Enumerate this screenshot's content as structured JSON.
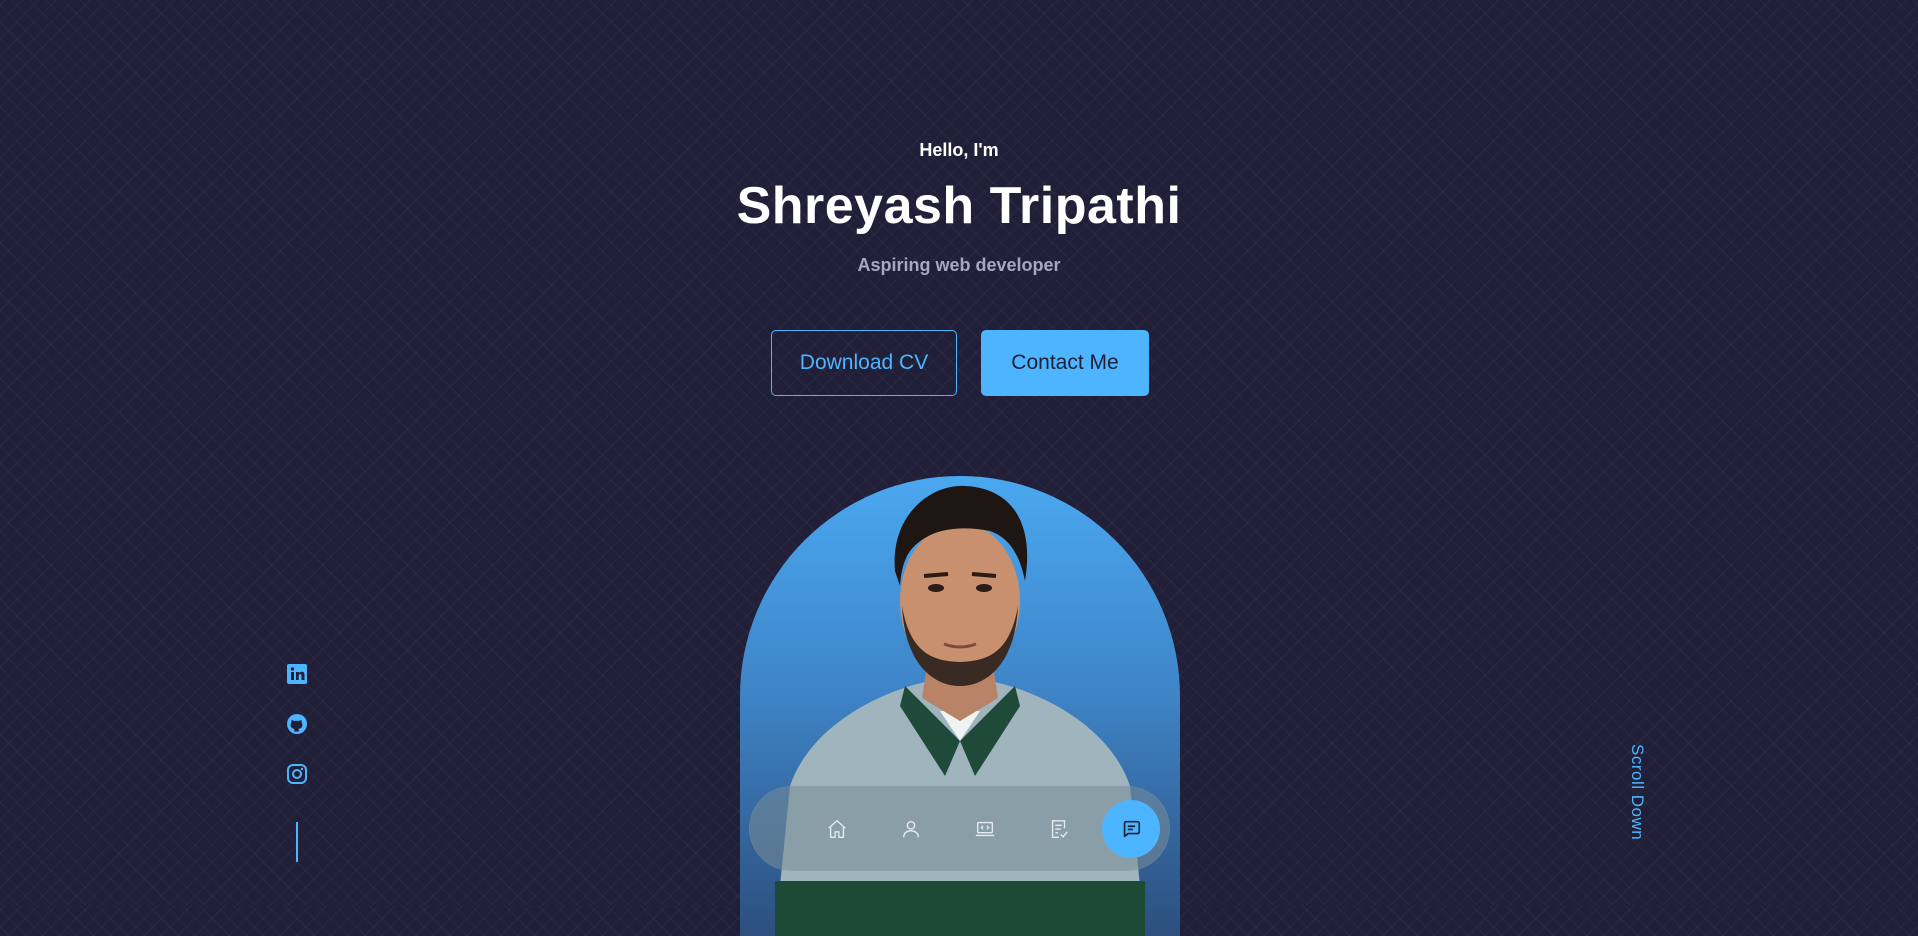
{
  "hero": {
    "greeting": "Hello, I'm",
    "name": "Shreyash Tripathi",
    "role": "Aspiring web developer"
  },
  "buttons": {
    "download_cv": "Download CV",
    "contact_me": "Contact Me"
  },
  "socials": [
    {
      "icon": "linkedin-icon"
    },
    {
      "icon": "github-icon"
    },
    {
      "icon": "instagram-icon"
    }
  ],
  "scroll_down": "Scroll Down",
  "nav": {
    "items": [
      {
        "icon": "home-icon",
        "active": false
      },
      {
        "icon": "user-icon",
        "active": false
      },
      {
        "icon": "laptop-code-icon",
        "active": false
      },
      {
        "icon": "notes-check-icon",
        "active": false
      },
      {
        "icon": "message-icon",
        "active": true
      }
    ]
  },
  "colors": {
    "background": "#211f38",
    "accent": "#4db5ff",
    "muted_text": "#a7a8c0"
  }
}
